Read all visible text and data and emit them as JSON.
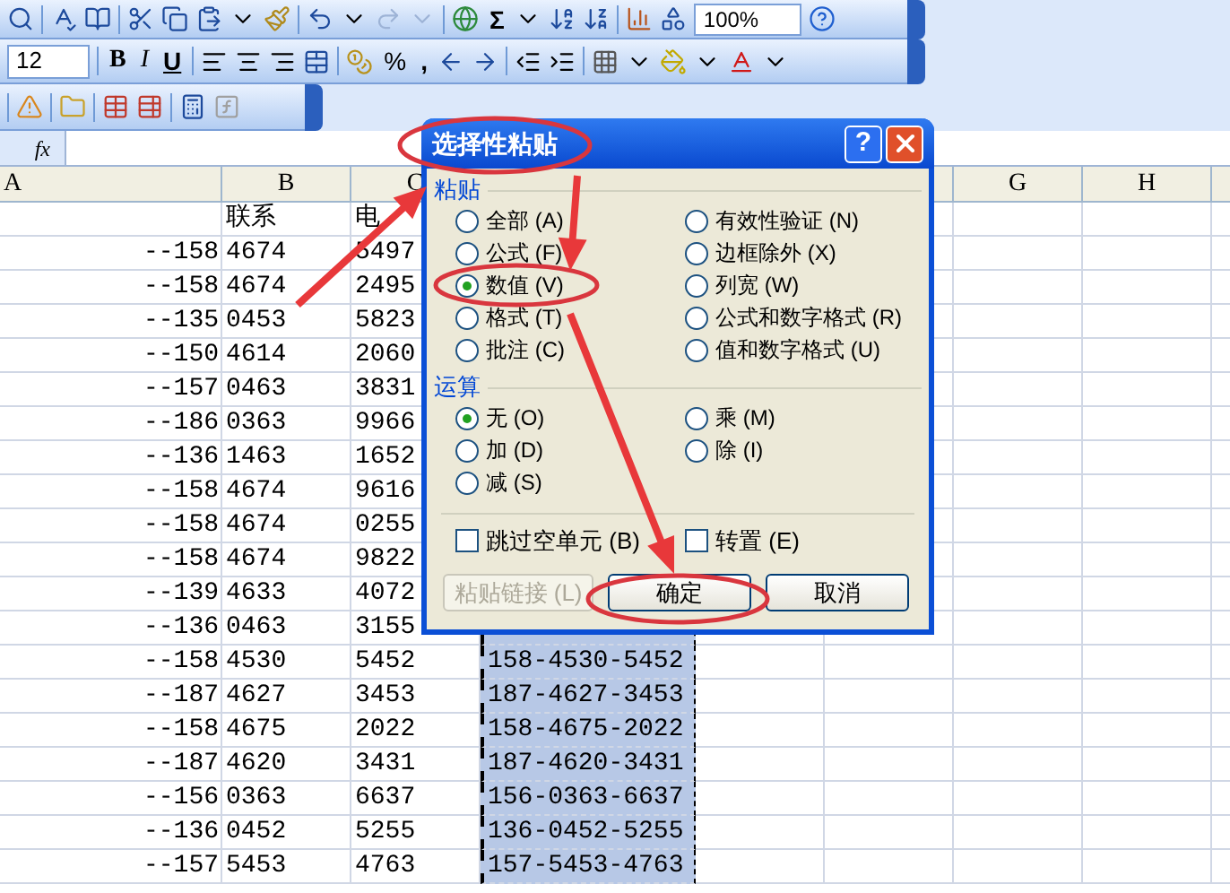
{
  "standard_toolbar": {
    "sum": "Σ",
    "zoom": "100%"
  },
  "formatting_toolbar": {
    "font_size": "12",
    "bold": "B",
    "italic": "I",
    "underline": "U",
    "percent": "%",
    "comma": ","
  },
  "formula_bar": {
    "fx": "fx"
  },
  "columns": [
    {
      "label": "A",
      "selected": false
    },
    {
      "label": "B",
      "selected": false
    },
    {
      "label": "C",
      "selected": false
    },
    {
      "selected": true
    },
    {
      "selected": false
    },
    {
      "selected": false
    },
    {
      "label": "G",
      "selected": false
    },
    {
      "label": "H",
      "selected": false
    }
  ],
  "rows": [
    {
      "B": "联系",
      "C": "电"
    },
    {
      "A": "--158",
      "B": "4674",
      "C": "5497"
    },
    {
      "A": "--158",
      "B": "4674",
      "C": "2495"
    },
    {
      "A": "--135",
      "B": "0453",
      "C": "5823"
    },
    {
      "A": "--150",
      "B": "4614",
      "C": "2060"
    },
    {
      "A": "--157",
      "B": "0463",
      "C": "3831"
    },
    {
      "A": "--186",
      "B": "0363",
      "C": "9966"
    },
    {
      "A": "--136",
      "B": "1463",
      "C": "1652"
    },
    {
      "A": "--158",
      "B": "4674",
      "C": "9616"
    },
    {
      "A": "--158",
      "B": "4674",
      "C": "0255"
    },
    {
      "A": "--158",
      "B": "4674",
      "C": "9822"
    },
    {
      "A": "--139",
      "B": "4633",
      "C": "4072"
    },
    {
      "A": "--136",
      "B": "0463",
      "C": "3155"
    },
    {
      "A": "--158",
      "B": "4530",
      "C": "5452",
      "D": "158-4530-5452"
    },
    {
      "A": "--187",
      "B": "4627",
      "C": "3453",
      "D": "187-4627-3453"
    },
    {
      "A": "--158",
      "B": "4675",
      "C": "2022",
      "D": "158-4675-2022"
    },
    {
      "A": "--187",
      "B": "4620",
      "C": "3431",
      "D": "187-4620-3431"
    },
    {
      "A": "--156",
      "B": "0363",
      "C": "6637",
      "D": "156-0363-6637"
    },
    {
      "A": "--136",
      "B": "0452",
      "C": "5255",
      "D": "136-0452-5255"
    },
    {
      "A": "--157",
      "B": "5453",
      "C": "4763",
      "D": "157-5453-4763"
    }
  ],
  "dialog": {
    "title": "选择性粘贴",
    "help": "?",
    "paste": {
      "label": "粘贴",
      "options": [
        {
          "label": "全部 (A)",
          "selected": false
        },
        {
          "label": "公式 (F)",
          "selected": false
        },
        {
          "label": "数值 (V)",
          "selected": true
        },
        {
          "label": "格式 (T)",
          "selected": false
        },
        {
          "label": "批注 (C)",
          "selected": false
        },
        {
          "label": "有效性验证 (N)",
          "selected": false
        },
        {
          "label": "边框除外 (X)",
          "selected": false
        },
        {
          "label": "列宽 (W)",
          "selected": false
        },
        {
          "label": "公式和数字格式 (R)",
          "selected": false
        },
        {
          "label": "值和数字格式 (U)",
          "selected": false
        }
      ]
    },
    "operation": {
      "label": "运算",
      "options": [
        {
          "label": "无 (O)",
          "selected": true
        },
        {
          "label": "加 (D)",
          "selected": false
        },
        {
          "label": "减 (S)",
          "selected": false
        },
        {
          "label": "乘 (M)",
          "selected": false
        },
        {
          "label": "除 (I)",
          "selected": false
        }
      ]
    },
    "checkboxes": [
      {
        "label": "跳过空单元 (B)",
        "checked": false
      },
      {
        "label": "转置 (E)",
        "checked": false
      }
    ],
    "buttons": [
      {
        "label": "粘贴链接 (L)",
        "disabled": true
      },
      {
        "label": "确定",
        "disabled": false
      },
      {
        "label": "取消",
        "disabled": false
      }
    ]
  }
}
